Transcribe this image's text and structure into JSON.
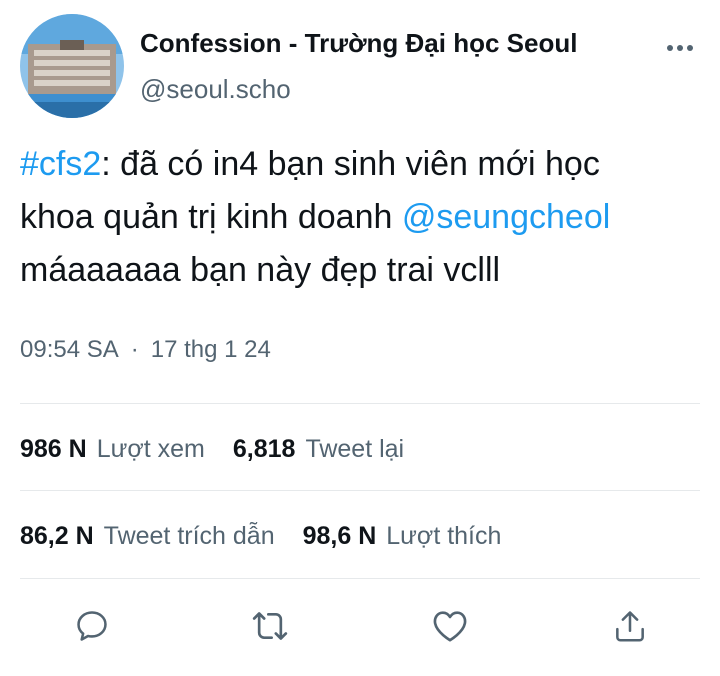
{
  "account": {
    "display_name": "Confession - Trường Đại học Seoul",
    "handle": "@seoul.scho",
    "avatar_icon": "building-photo"
  },
  "tweet": {
    "hashtag": "#cfs2",
    "text_part1": ": đã có in4 bạn sinh viên mới học",
    "line2_text": "khoa quản trị kinh doanh ",
    "mention": "@seungcheol",
    "line3_text": "máaaaaaa bạn này đẹp trai vclll"
  },
  "meta": {
    "time": "09:54 SA",
    "separator": "·",
    "date": "17 thg 1 24"
  },
  "stats": {
    "views_count": "986 N",
    "views_label": "Lượt xem",
    "retweets_count": "6,818",
    "retweets_label": "Tweet lại",
    "quotes_count": "86,2 N",
    "quotes_label": "Tweet trích dẫn",
    "likes_count": "98,6 N",
    "likes_label": "Lượt thích"
  },
  "actions": {
    "reply_icon": "reply-icon",
    "retweet_icon": "retweet-icon",
    "like_icon": "like-icon",
    "share_icon": "share-icon"
  },
  "colors": {
    "link": "#1d9bf0",
    "secondary_text": "#536471",
    "primary_text": "#0f1419",
    "divider": "#e6e9eb"
  }
}
